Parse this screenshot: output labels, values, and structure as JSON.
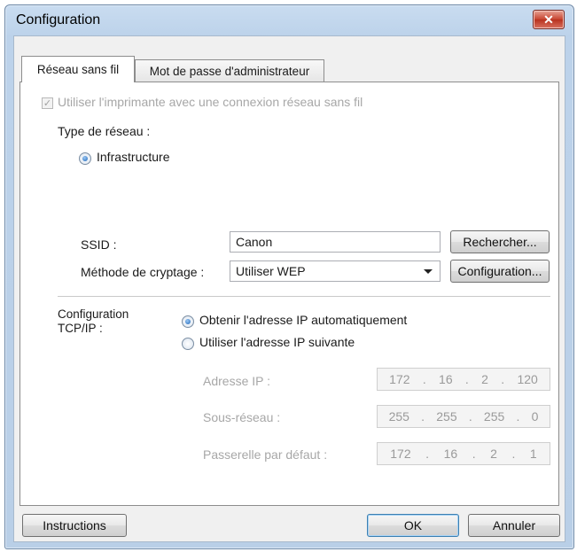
{
  "window": {
    "title": "Configuration",
    "close_glyph": "✕"
  },
  "tabs": [
    {
      "label": "Réseau sans fil",
      "active": true
    },
    {
      "label": "Mot de passe d'administrateur",
      "active": false
    }
  ],
  "wireless": {
    "use_printer_checkbox": {
      "label": "Utiliser l'imprimante avec une connexion réseau sans fil",
      "checked": true,
      "enabled": false
    },
    "network_type_label": "Type de réseau :",
    "infrastructure_label": "Infrastructure",
    "ssid_label": "SSID :",
    "ssid_value": "Canon",
    "search_button": "Rechercher...",
    "encryption_label": "Méthode de cryptage :",
    "encryption_value": "Utiliser WEP",
    "encryption_config_button": "Configuration..."
  },
  "tcpip": {
    "section_label_line1": "Configuration",
    "section_label_line2": "TCP/IP :",
    "auto_ip_label": "Obtenir l'adresse IP automatiquement",
    "manual_ip_label": "Utiliser l'adresse IP suivante",
    "selected": "auto",
    "ip_address_label": "Adresse IP :",
    "ip_address": [
      "172",
      "16",
      "2",
      "120"
    ],
    "subnet_label": "Sous-réseau :",
    "subnet": [
      "255",
      "255",
      "255",
      "0"
    ],
    "gateway_label": "Passerelle par défaut :",
    "gateway": [
      "172",
      "16",
      "2",
      "1"
    ]
  },
  "footer": {
    "instructions_button": "Instructions",
    "ok_button": "OK",
    "cancel_button": "Annuler"
  }
}
